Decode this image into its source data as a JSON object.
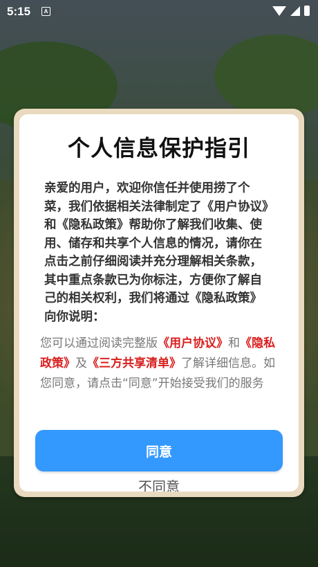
{
  "status_bar": {
    "time": "5:15",
    "notification_glyph": "A",
    "icons": [
      "wifi-icon",
      "signal-icon",
      "battery-icon"
    ]
  },
  "dialog": {
    "title": "个人信息保护指引",
    "intro": "亲爱的用户，欢迎你信任并使用捞了个菜，我们依据相关法律制定了《用户协议》和《隐私政策》帮助你了解我们收集、使用、储存和共享个人信息的情况，请你在点击之前仔细阅读并充分理解相关条款，其中重点条款已为你标注，方便你了解自己的相关权利，我们将通过《隐私政策》向你说明：",
    "note": {
      "part1": "您可以通过阅读完整版",
      "link_user_agreement": "《用户协议》",
      "part2": "和",
      "link_privacy_policy": "《隐私政策》",
      "part3": "及",
      "link_sharing_list": "《三方共享清单》",
      "part4": "了解详细信息。如您同意，请点击“同意”开始接受我们的服务"
    },
    "agree_label": "同意",
    "disagree_label": "不同意"
  },
  "colors": {
    "accent_blue": "#3399ff",
    "link_red": "#d91e1e",
    "dialog_frame": "#e8d9bf"
  }
}
